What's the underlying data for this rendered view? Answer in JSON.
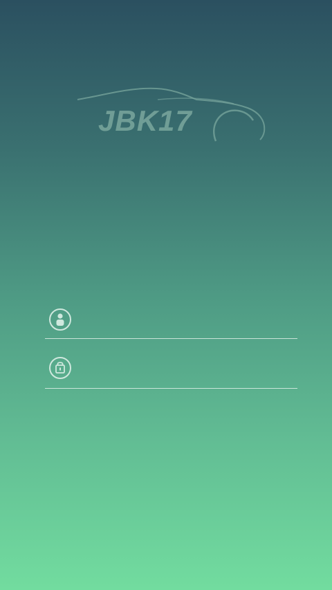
{
  "app": {
    "logo_text": "JBK17",
    "logo_icon": "car-silhouette-logo"
  },
  "login": {
    "username": {
      "icon": "user-icon",
      "value": "",
      "placeholder": ""
    },
    "password": {
      "icon": "lock-icon",
      "value": "",
      "placeholder": ""
    }
  },
  "colors": {
    "gradient_top": "#2b5060",
    "gradient_bottom": "#72dc9f",
    "underline": "#e1f0e8",
    "icon_stroke": "#cfe8de",
    "logo": "#7aa79e"
  }
}
